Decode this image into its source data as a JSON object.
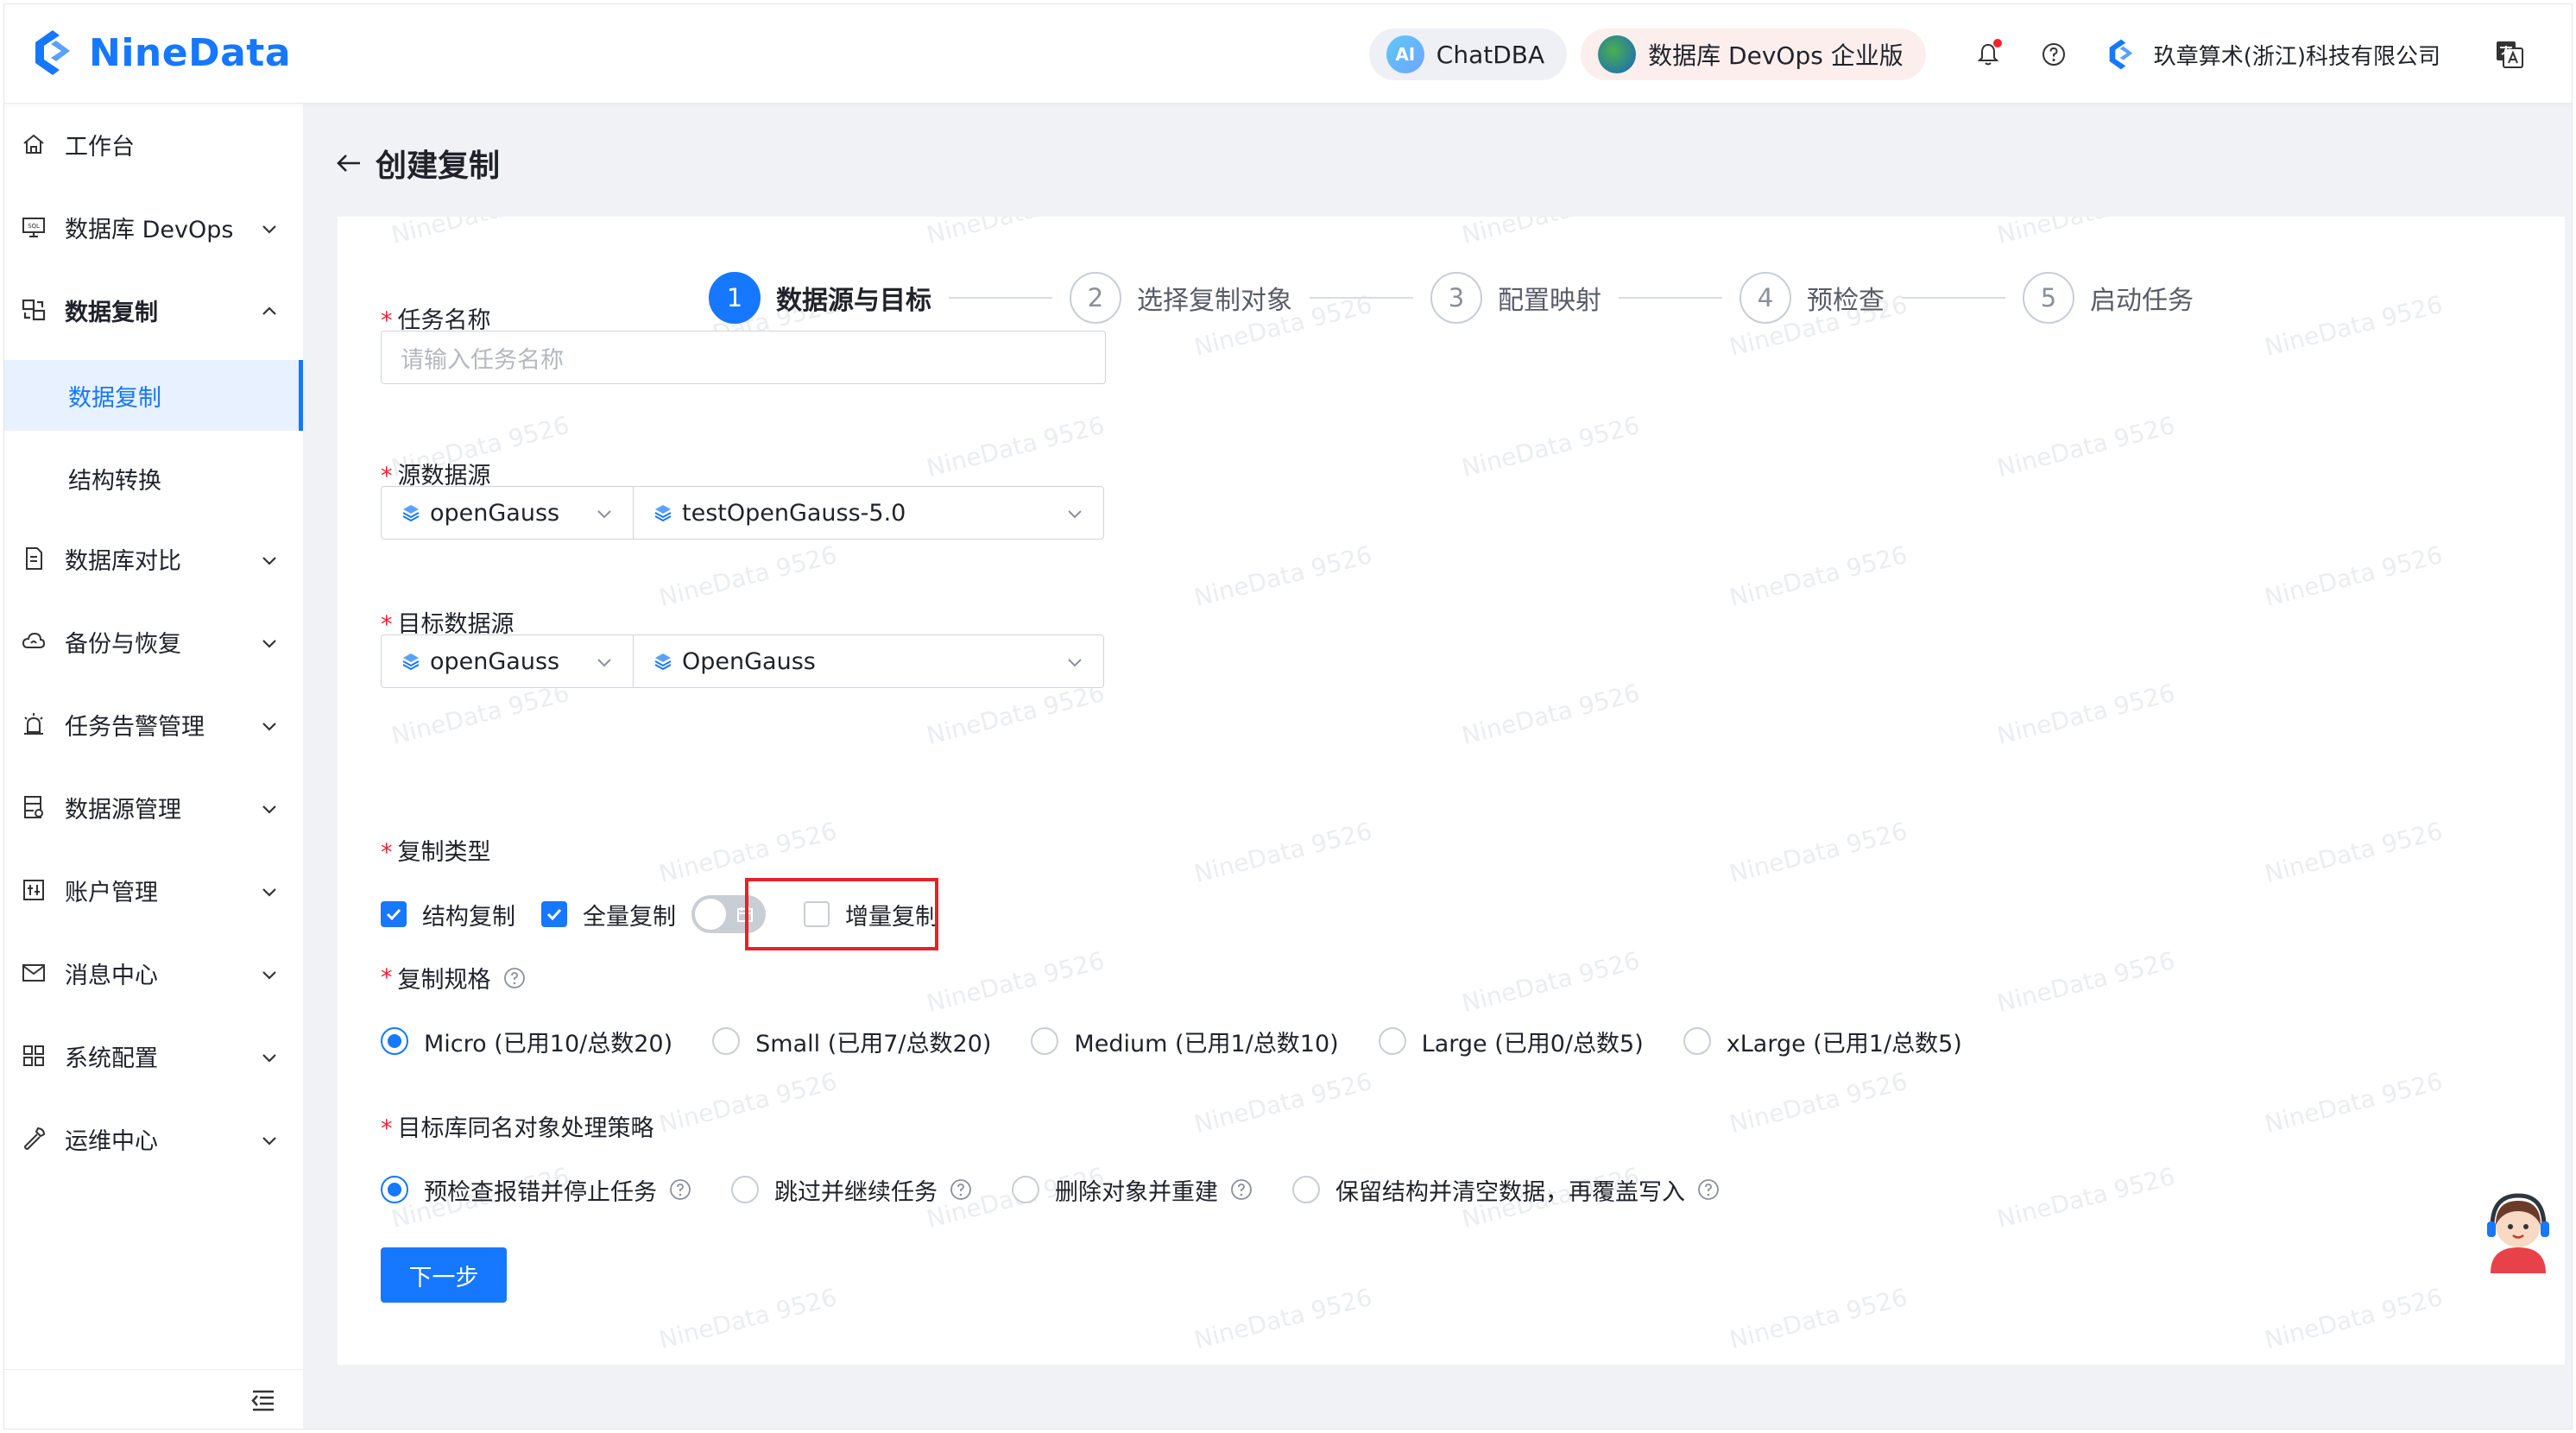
{
  "header": {
    "brand": "NineData",
    "chatdba": "ChatDBA",
    "chatdba_icon": "AI",
    "devops": "数据库 DevOps 企业版",
    "company": "玖章算术(浙江)科技有限公司"
  },
  "sidebar": {
    "items": [
      {
        "label": "工作台",
        "icon": "home-icon"
      },
      {
        "label": "数据库 DevOps",
        "icon": "sql-monitor-icon"
      },
      {
        "label": "数据复制",
        "icon": "replication-icon"
      },
      {
        "label": "数据库对比",
        "icon": "document-compare-icon"
      },
      {
        "label": "备份与恢复",
        "icon": "cloud-backup-icon"
      },
      {
        "label": "任务告警管理",
        "icon": "alarm-icon"
      },
      {
        "label": "数据源管理",
        "icon": "database-icon"
      },
      {
        "label": "账户管理",
        "icon": "account-icon"
      },
      {
        "label": "消息中心",
        "icon": "mail-icon"
      },
      {
        "label": "系统配置",
        "icon": "grid-icon"
      },
      {
        "label": "运维中心",
        "icon": "wrench-icon"
      }
    ],
    "sub_items": [
      "数据复制",
      "结构转换"
    ]
  },
  "page": {
    "title": "创建复制",
    "watermark": "NineData 9526"
  },
  "steps": [
    {
      "num": "1",
      "label": "数据源与目标"
    },
    {
      "num": "2",
      "label": "选择复制对象"
    },
    {
      "num": "3",
      "label": "配置映射"
    },
    {
      "num": "4",
      "label": "预检查"
    },
    {
      "num": "5",
      "label": "启动任务"
    }
  ],
  "form": {
    "task_name_label": "任务名称",
    "task_name_placeholder": "请输入任务名称",
    "source_label": "源数据源",
    "source_type": "openGauss",
    "source_instance": "testOpenGauss-5.0",
    "target_label": "目标数据源",
    "target_type": "openGauss",
    "target_instance": "OpenGauss",
    "copy_type_label": "复制类型",
    "copy_types": [
      {
        "label": "结构复制",
        "checked": true
      },
      {
        "label": "全量复制",
        "checked": true
      },
      {
        "label": "增量复制",
        "checked": false
      }
    ],
    "spec_label": "复制规格",
    "specs": [
      {
        "label": "Micro (已用10/总数20)",
        "selected": true
      },
      {
        "label": "Small (已用7/总数20)",
        "selected": false
      },
      {
        "label": "Medium (已用1/总数10)",
        "selected": false
      },
      {
        "label": "Large (已用0/总数5)",
        "selected": false
      },
      {
        "label": "xLarge (已用1/总数5)",
        "selected": false
      }
    ],
    "strategy_label": "目标库同名对象处理策略",
    "strategies": [
      {
        "label": "预检查报错并停止任务",
        "selected": true
      },
      {
        "label": "跳过并继续任务",
        "selected": false
      },
      {
        "label": "删除对象并重建",
        "selected": false
      },
      {
        "label": "保留结构并清空数据，再覆盖写入",
        "selected": false
      }
    ],
    "next_button": "下一步"
  },
  "colors": {
    "primary": "#1677ff",
    "highlight": "#e4222a",
    "required": "#f5222d"
  }
}
